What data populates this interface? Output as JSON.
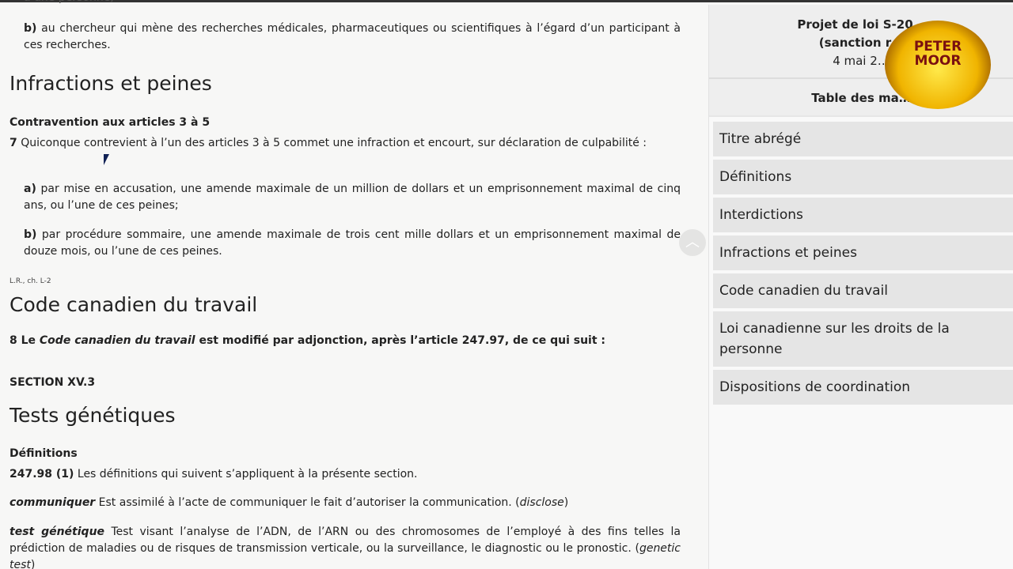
{
  "main": {
    "cut_line": "à une personne;",
    "b1_label": "b)",
    "b1_text": " au chercheur qui mène des recherches médicales, pharmaceutiques ou scientifiques à l’égard d’un participant à ces recherches.",
    "h_infractions": "Infractions et peines",
    "h_contravention": "Contravention aux articles 3 à 5",
    "s7_num": "7",
    "s7_text": " Quiconque contrevient à l’un des articles 3 à 5 commet une infraction et encourt, sur déclaration de culpabilité :",
    "a_label": "a)",
    "a_text": " par mise en accusation, une amende maximale de un million de dollars et un emprisonnement maximal de cinq ans, ou l’une de ces peines;",
    "b2_label": "b)",
    "b2_text": " par procédure sommaire, une amende maximale de trois cent mille dollars et un emprisonnement maximal de douze mois, ou l’une de ces peines.",
    "ref": "L.R., ch. L-2",
    "h_code": "Code canadien du travail",
    "s8_a": "8 Le ",
    "s8_i": "Code canadien du travail",
    "s8_b": " est modifié par adjonction, après l’article 247.97, de ce qui suit :",
    "section": "SECTION XV.3",
    "h_tests": "Tests génétiques",
    "h_defs": "Définitions",
    "s247_num": "247.98 (1)",
    "s247_text": " Les définitions qui suivent s’appliquent à la présente section.",
    "comm_term": "communiquer",
    "comm_text": " Est assimilé à l’acte de communiquer le fait d’autoriser la communication. (",
    "comm_en": "disclose",
    "comm_end": ")",
    "test_term": "test génétique",
    "test_text": " Test visant l’analyse de l’ADN, de l’ARN ou des chromosomes de l’employé à des fins telles la prédiction de maladies ou de risques de transmission verticale, ou la surveillance, le diagnostic ou le pronostic. (",
    "test_en": "genetic test",
    "test_end": ")"
  },
  "sidebar": {
    "title_line1": "Projet de loi S-20…",
    "title_line2": "(sanction r…",
    "date": "4 mai 2…",
    "toc": "Table des ma…",
    "items": [
      "Titre abrégé",
      "Définitions",
      "Interdictions",
      "Infractions et peines",
      "Code canadien du travail",
      "Loi canadienne sur les droits de la personne",
      "Dispositions de coordination"
    ]
  },
  "watermark": {
    "text1": "PETER",
    "text2": "MOOR"
  }
}
